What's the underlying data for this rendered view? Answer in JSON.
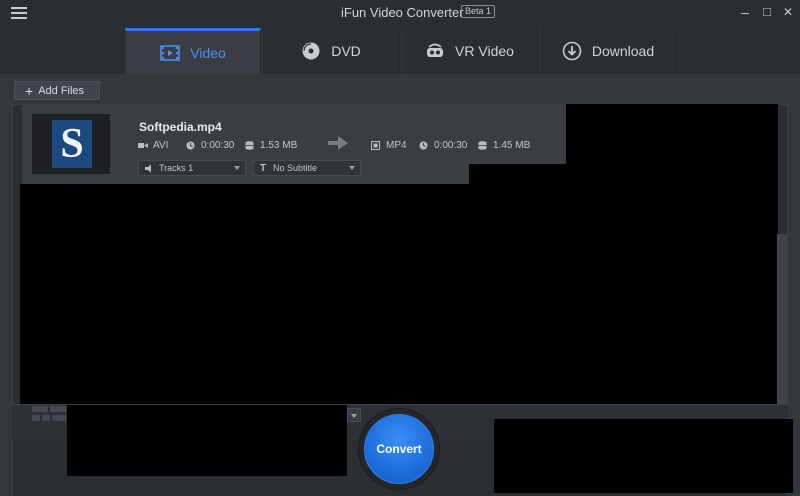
{
  "window": {
    "title": "iFun Video Converter",
    "badge": "Beta 1",
    "minimize": "–",
    "maximize": "□",
    "close": "✕"
  },
  "tabs": [
    {
      "label": "Video",
      "icon": "film-icon",
      "active": true
    },
    {
      "label": "DVD",
      "icon": "disc-icon",
      "active": false
    },
    {
      "label": "VR Video",
      "icon": "vr-headset-icon",
      "active": false
    },
    {
      "label": "Download",
      "icon": "download-icon",
      "active": false
    }
  ],
  "toolbar": {
    "add_files_label": "Add Files"
  },
  "file": {
    "name": "Softpedia.mp4",
    "thumbnail_letter": "S",
    "source": {
      "format": "AVI",
      "duration": "0:00:30",
      "size": "1.53 MB"
    },
    "target": {
      "format": "MP4",
      "duration": "0:00:30",
      "size": "1.45 MB"
    },
    "audio_track": "Tracks 1",
    "subtitle": "No Subtitle"
  },
  "actions": {
    "convert_label": "Convert"
  },
  "colors": {
    "accent": "#2b7de3",
    "background": "#2a2d31",
    "panel": "#34373c",
    "convert": "#1f6fde"
  }
}
